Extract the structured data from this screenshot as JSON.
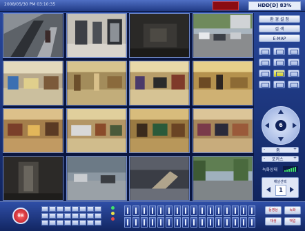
{
  "header": {
    "datetime": "2008/05/30 PM 03:10:35",
    "hdd_status": "HDD[D] 83%"
  },
  "cameras": [
    {
      "id": 1,
      "scene": "escalator"
    },
    {
      "id": 2,
      "scene": "elevator-hall"
    },
    {
      "id": 3,
      "scene": "dark-corridor"
    },
    {
      "id": 4,
      "scene": "outdoor-parking"
    },
    {
      "id": 5,
      "scene": "store-floor"
    },
    {
      "id": 6,
      "scene": "store-floor"
    },
    {
      "id": 7,
      "scene": "store-floor"
    },
    {
      "id": 8,
      "scene": "store-floor"
    },
    {
      "id": 9,
      "scene": "store-floor"
    },
    {
      "id": 10,
      "scene": "store-floor"
    },
    {
      "id": 11,
      "scene": "store-floor"
    },
    {
      "id": 12,
      "scene": "store-floor"
    },
    {
      "id": 13,
      "scene": "dark-entrance"
    },
    {
      "id": 14,
      "scene": "street"
    },
    {
      "id": 15,
      "scene": "aisle-display"
    },
    {
      "id": 16,
      "scene": "outdoor-road"
    }
  ],
  "panel": {
    "setup_label": "환 경 설 정",
    "search_label": "검 색",
    "emap_label": "E-MAP",
    "ptz_number": "6",
    "ctrl1_left": "-",
    "ctrl1_mid": "줌",
    "ctrl1_right": "+",
    "ctrl2_left": "-",
    "ctrl2_mid": "포커스",
    "ctrl2_right": "+",
    "meter_label": "녹화상태",
    "channel_caption": "채널선택",
    "channel_number": "1"
  },
  "bottom": {
    "exit_label": "종료",
    "btn1": "동영상",
    "btn2": "녹화",
    "btn3": "재생",
    "btn4": "백업"
  },
  "colors": {
    "background": "#1a2f6b",
    "panel": "#2a4aa0",
    "alarm": "#8a0c12",
    "active_layout": "#d8d52a"
  }
}
